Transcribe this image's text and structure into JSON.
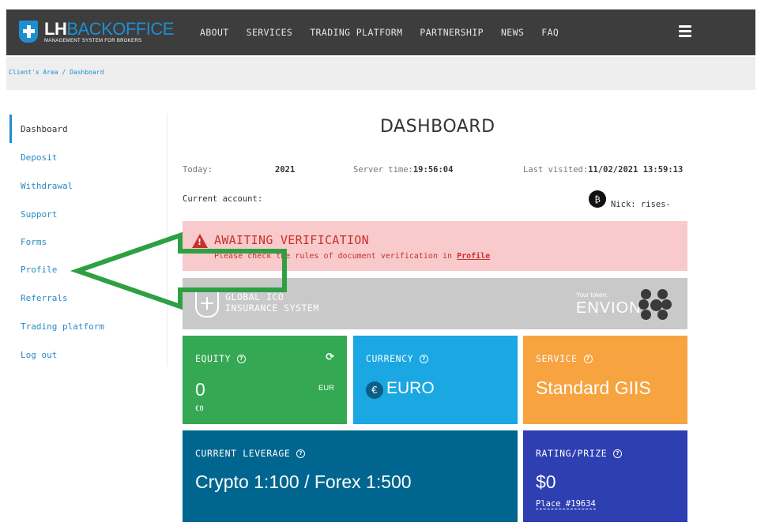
{
  "header": {
    "logo_main_bold": "LH",
    "logo_main_light": "BACKOFFICE",
    "logo_sub": "MANAGEMENT SYSTEM FOR BROKERS",
    "nav": [
      "ABOUT",
      "SERVICES",
      "TRADING PLATFORM",
      "PARTNERSHIP",
      "NEWS",
      "FAQ"
    ]
  },
  "breadcrumb": "Client's Area / Dashboard",
  "sidebar": {
    "items": [
      "Dashboard",
      "Deposit",
      "Withdrawal",
      "Support",
      "Forms",
      "Profile",
      "Referrals",
      "Trading platform",
      "Log out"
    ],
    "active": "Dashboard"
  },
  "main": {
    "title": "DASHBOARD",
    "today_label": "Today:",
    "today_value": "2021",
    "server_time_label": "Server time:",
    "server_time_value": "19:56:04",
    "last_visited_label": "Last visited:",
    "last_visited_value": "11/02/2021 13:59:13",
    "current_account_label": "Current account:",
    "user_name": "Nick: rises-"
  },
  "alert": {
    "title": "AWAITING VERIFICATION",
    "text_prefix": "Please check the rules of document verification in",
    "link": "Profile"
  },
  "ico_banner": {
    "line1": "GLOBAL ICO",
    "line2": "INSURANCE SYSTEM",
    "token_label": "Your token:",
    "token_name": "ENVION"
  },
  "cards": {
    "equity": {
      "label": "EQUITY",
      "value": "0",
      "currency": "EUR",
      "sub": "€0"
    },
    "currency": {
      "label": "CURRENCY",
      "symbol": "€",
      "value": "EURO"
    },
    "service": {
      "label": "SERVICE",
      "value": "Standard GIIS"
    },
    "leverage": {
      "label": "CURRENT LEVERAGE",
      "value": "Crypto 1:100 / Forex 1:500"
    },
    "rating": {
      "label": "RATING/PRIZE",
      "value": "$0",
      "place": "Place #19634"
    }
  },
  "icons": {
    "help": "?",
    "warning": "!",
    "refresh": "⟳",
    "avatar": "₿"
  },
  "colors": {
    "header_bg": "#3d3d3d",
    "brand_blue": "#1d8fd1",
    "alert_bg": "#f8cacb",
    "alert_text": "#c9302c",
    "equity": "#34a853",
    "currency": "#1aa7e2",
    "service": "#f7a33f",
    "leverage": "#00668f",
    "rating": "#2e3fb2",
    "annotation_arrow": "#2ea043"
  }
}
